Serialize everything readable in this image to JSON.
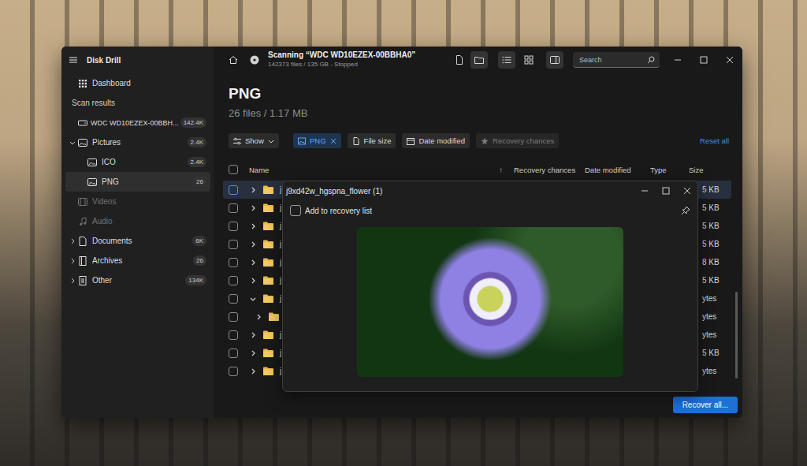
{
  "window": {
    "title": "Scanning “WDC WD10EZEX-00BBHA0”",
    "subtitle": "142373 files / 135 GB - Stopped"
  },
  "sidebar": {
    "app_title": "Disk Drill",
    "items": [
      {
        "kind": "link",
        "label": "Dashboard",
        "selected": false,
        "disabled": false
      },
      {
        "kind": "heading",
        "label": "Scan results",
        "selected": false,
        "disabled": false
      },
      {
        "kind": "drive",
        "label": "WDC WD10EZEX-00BBH...",
        "count": "142.4K",
        "selected": false,
        "disabled": false
      },
      {
        "kind": "group",
        "label": "Pictures",
        "count": "2.4K",
        "expanded": true,
        "selected": false,
        "disabled": false
      },
      {
        "kind": "sub",
        "label": "ICO",
        "count": "2.4K",
        "selected": false,
        "disabled": false
      },
      {
        "kind": "sub",
        "label": "PNG",
        "count": "26",
        "selected": true,
        "disabled": false
      },
      {
        "kind": "group",
        "label": "Videos",
        "selected": false,
        "disabled": true
      },
      {
        "kind": "group",
        "label": "Audio",
        "selected": false,
        "disabled": true
      },
      {
        "kind": "group",
        "label": "Documents",
        "count": "6K",
        "expanded": false,
        "selected": false,
        "disabled": false
      },
      {
        "kind": "group",
        "label": "Archives",
        "count": "26",
        "expanded": false,
        "selected": false,
        "disabled": false
      },
      {
        "kind": "group",
        "label": "Other",
        "count": "134K",
        "expanded": false,
        "selected": false,
        "disabled": false
      }
    ]
  },
  "toolbar": {
    "view_buttons": [
      {
        "selected": false
      },
      {
        "selected": true
      },
      {
        "selected": true
      },
      {
        "selected": false
      },
      {
        "selected": true
      }
    ],
    "search": {
      "placeholder": "Search"
    }
  },
  "heading": {
    "title": "PNG",
    "summary": "26 files / 1.17 MB"
  },
  "filters": {
    "show": "Show",
    "chips": [
      {
        "label": "PNG",
        "active": true,
        "disabled": false
      },
      {
        "label": "File size",
        "active": false,
        "disabled": false
      },
      {
        "label": "Date modified",
        "active": false,
        "disabled": false
      },
      {
        "label": "Recovery chances",
        "active": false,
        "disabled": true
      }
    ],
    "reset": "Reset all"
  },
  "table": {
    "header_checked": false,
    "columns": [
      {
        "label": "Name",
        "sorted": true,
        "sort_icon": "↑"
      },
      {
        "label": "Recovery chances",
        "sorted": false
      },
      {
        "label": "Date modified",
        "sorted": false
      },
      {
        "label": "Type",
        "sorted": false
      },
      {
        "label": "Size",
        "sorted": false
      }
    ],
    "rows": [
      {
        "name": "j",
        "size": "5 KB",
        "checked": false,
        "selected": true,
        "expanded": false,
        "child": false
      },
      {
        "name": "j",
        "size": "5 KB",
        "checked": false,
        "selected": false,
        "expanded": false,
        "child": false
      },
      {
        "name": "j",
        "size": "5 KB",
        "checked": false,
        "selected": false,
        "expanded": false,
        "child": false
      },
      {
        "name": "j",
        "size": "5 KB",
        "checked": false,
        "selected": false,
        "expanded": false,
        "child": false
      },
      {
        "name": "j",
        "size": "8 KB",
        "checked": false,
        "selected": false,
        "expanded": false,
        "child": false
      },
      {
        "name": "j",
        "size": "5 KB",
        "checked": false,
        "selected": false,
        "expanded": false,
        "child": false
      },
      {
        "name": "j",
        "size": "ytes",
        "checked": false,
        "selected": false,
        "expanded": true,
        "child": false
      },
      {
        "size": "ytes",
        "checked": false,
        "selected": false,
        "expanded": false,
        "child": true
      },
      {
        "name": "j",
        "size": "ytes",
        "checked": false,
        "selected": false,
        "expanded": false,
        "child": false
      },
      {
        "name": "j",
        "size": "5 KB",
        "checked": false,
        "selected": false,
        "expanded": false,
        "child": false
      },
      {
        "name": "j",
        "size": "ytes",
        "checked": false,
        "selected": false,
        "expanded": false,
        "child": false
      }
    ]
  },
  "preview": {
    "title": "j9xd42w_hgspna_flower (1)",
    "add_label": "Add to recovery list",
    "checked": false
  },
  "footer": {
    "button": "Recover all..."
  }
}
